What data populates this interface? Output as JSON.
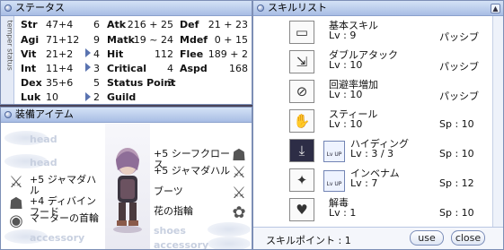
{
  "status": {
    "title": "ステータス",
    "side_label": "temper status",
    "stats": [
      {
        "name": "Str",
        "value": "47+4",
        "cost": "6"
      },
      {
        "name": "Agi",
        "value": "71+12",
        "cost": "9"
      },
      {
        "name": "Vit",
        "value": "21+2",
        "cost": "4"
      },
      {
        "name": "Int",
        "value": "11+4",
        "cost": "3"
      },
      {
        "name": "Dex",
        "value": "35+6",
        "cost": "5"
      },
      {
        "name": "Luk",
        "value": "10",
        "cost": "2"
      }
    ],
    "combat": [
      {
        "name": "Atk",
        "value": "216 + 25"
      },
      {
        "name": "Matk",
        "value": "19 ~ 24"
      },
      {
        "name": "Hit",
        "value": "112"
      },
      {
        "name": "Critical",
        "value": "4"
      },
      {
        "name": "Status Point",
        "value": "3"
      },
      {
        "name": "Guild",
        "value": ""
      }
    ],
    "defense": [
      {
        "name": "Def",
        "value": "21 + 23"
      },
      {
        "name": "Mdef",
        "value": "0 + 15"
      },
      {
        "name": "Flee",
        "value": "189 + 2"
      },
      {
        "name": "Aspd",
        "value": "168"
      }
    ]
  },
  "equip": {
    "title": "装備アイテム",
    "left": [
      {
        "label": "head",
        "ghost": true
      },
      {
        "label": "head",
        "ghost": true
      },
      {
        "label": "+5 ジャマダハル",
        "ghost": false
      },
      {
        "label": "+4 ディバインフード",
        "ghost": false
      },
      {
        "label": "マーターの首輪",
        "ghost": false
      },
      {
        "label": "accessory",
        "ghost": true
      }
    ],
    "right": [
      {
        "label": "+5 シーフクロース",
        "ghost": false
      },
      {
        "label": "+5 ジャマダハル",
        "ghost": false
      },
      {
        "label": "ブーツ",
        "ghost": false
      },
      {
        "label": "花の指輪",
        "ghost": false
      },
      {
        "label": "shoes",
        "ghost": true
      },
      {
        "label": "accessory",
        "ghost": true
      }
    ]
  },
  "skill": {
    "title": "スキルリスト",
    "skills": [
      {
        "name": "基本スキル",
        "lv": "Lv : 9",
        "type": "パッシブ",
        "icon": "basic-skill-icon"
      },
      {
        "name": "ダブルアタック",
        "lv": "Lv : 10",
        "type": "パッシブ",
        "icon": "double-attack-icon"
      },
      {
        "name": "回避率増加",
        "lv": "Lv : 10",
        "type": "パッシブ",
        "icon": "improve-dodge-icon"
      },
      {
        "name": "スティール",
        "lv": "Lv : 10",
        "type": "Sp : 10",
        "icon": "steal-icon"
      },
      {
        "name": "ハイディング",
        "lv": "Lv :  3 / 3",
        "type": "Sp : 10",
        "icon": "hiding-icon",
        "lvup": "Lv UP"
      },
      {
        "name": "インベナム",
        "lv": "Lv : 7",
        "type": "Sp : 12",
        "icon": "envenom-icon",
        "lvup": "Lv UP"
      },
      {
        "name": "解毒",
        "lv": "Lv : 1",
        "type": "Sp : 10",
        "icon": "detoxify-icon"
      }
    ],
    "points_label": "スキルポイント : 1",
    "use_label": "use",
    "close_label": "close"
  }
}
